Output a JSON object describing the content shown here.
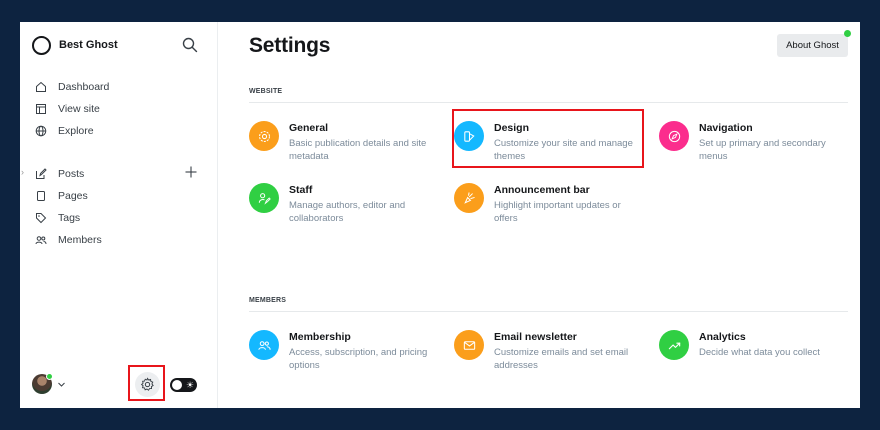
{
  "sidebar": {
    "site_name": "Best Ghost",
    "nav_primary": [
      {
        "label": "Dashboard",
        "icon": "home-icon"
      },
      {
        "label": "View site",
        "icon": "window-icon"
      },
      {
        "label": "Explore",
        "icon": "globe-icon"
      }
    ],
    "nav_secondary": [
      {
        "label": "Posts",
        "icon": "pencil-icon"
      },
      {
        "label": "Pages",
        "icon": "page-icon"
      },
      {
        "label": "Tags",
        "icon": "tag-icon"
      },
      {
        "label": "Members",
        "icon": "members-icon"
      }
    ]
  },
  "header": {
    "title": "Settings",
    "about_label": "About Ghost"
  },
  "sections": {
    "website": {
      "label": "WEBSITE",
      "tiles": [
        {
          "title": "General",
          "desc": "Basic publication details and site metadata",
          "color": "#fb9e1b",
          "icon": "gear-icon"
        },
        {
          "title": "Design",
          "desc": "Customize your site and manage themes",
          "color": "#14b8ff",
          "icon": "brush-icon"
        },
        {
          "title": "Navigation",
          "desc": "Set up primary and secondary menus",
          "color": "#fb2d8d",
          "icon": "compass-icon"
        },
        {
          "title": "Staff",
          "desc": "Manage authors, editor and collaborators",
          "color": "#30cf43",
          "icon": "staff-icon"
        },
        {
          "title": "Announcement bar",
          "desc": "Highlight important updates or offers",
          "color": "#fb9e1b",
          "icon": "megaphone-icon"
        }
      ]
    },
    "members": {
      "label": "MEMBERS",
      "tiles": [
        {
          "title": "Membership",
          "desc": "Access, subscription, and pricing options",
          "color": "#14b8ff",
          "icon": "membership-icon"
        },
        {
          "title": "Email newsletter",
          "desc": "Customize emails and set email addresses",
          "color": "#fb9e1b",
          "icon": "envelope-icon"
        },
        {
          "title": "Analytics",
          "desc": "Decide what data you collect",
          "color": "#30cf43",
          "icon": "trend-icon"
        }
      ]
    }
  },
  "colors": {
    "outer_background": "#0d2340",
    "highlight_box": "#e8151b",
    "online_dot": "#30cf43"
  }
}
